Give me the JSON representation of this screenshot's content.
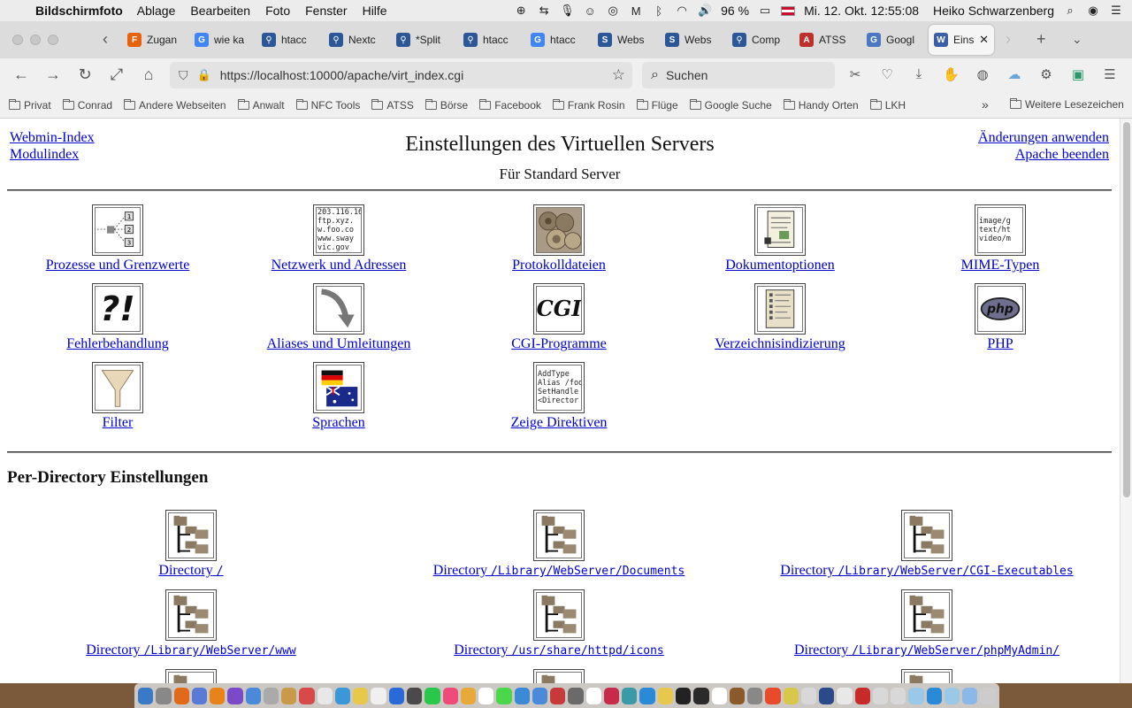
{
  "menubar": {
    "app": "Bildschirmfoto",
    "items": [
      "Ablage",
      "Bearbeiten",
      "Foto",
      "Fenster",
      "Hilfe"
    ],
    "battery": "96 %",
    "datetime": "Mi. 12. Okt.  12:55:08",
    "user": "Heiko Schwarzenberg"
  },
  "tabs": [
    {
      "title": "Zugan",
      "color": "#e8620c",
      "glyph": "F"
    },
    {
      "title": "wie ka",
      "color": "#4285f4",
      "glyph": "G"
    },
    {
      "title": "htacc",
      "color": "#2b5797",
      "glyph": "⚲"
    },
    {
      "title": "Nextc",
      "color": "#2b5797",
      "glyph": "⚲"
    },
    {
      "title": "*Split",
      "color": "#2b5797",
      "glyph": "⚲"
    },
    {
      "title": "htacc",
      "color": "#2b5797",
      "glyph": "⚲"
    },
    {
      "title": "htacc",
      "color": "#4285f4",
      "glyph": "G"
    },
    {
      "title": "Webs",
      "color": "#2b5797",
      "glyph": "S"
    },
    {
      "title": "Webs",
      "color": "#2b5797",
      "glyph": "S"
    },
    {
      "title": "Comp",
      "color": "#2b5797",
      "glyph": "⚲"
    },
    {
      "title": "ATSS",
      "color": "#c0302a",
      "glyph": "A"
    },
    {
      "title": "Googl",
      "color": "#4a78c2",
      "glyph": "G"
    },
    {
      "title": "Einst",
      "color": "#3a5fa8",
      "glyph": "W",
      "active": true
    }
  ],
  "navbar": {
    "url": "https://localhost:10000/apache/virt_index.cgi",
    "search_placeholder": "Suchen"
  },
  "bookmarks": [
    "Privat",
    "Conrad",
    "Andere Webseiten",
    "Anwalt",
    "NFC Tools",
    "ATSS",
    "Börse",
    "Facebook",
    "Frank Rosin",
    "Flüge",
    "Google Suche",
    "Handy Orten",
    "LKH"
  ],
  "bookmarks_more": "Weitere Lesezeichen",
  "page": {
    "links_left": [
      "Webmin-Index",
      "Modulindex"
    ],
    "links_right": [
      "Änderungen anwenden",
      "Apache beenden"
    ],
    "title": "Einstellungen des Virtuellen Servers",
    "subtitle": "Für Standard Server",
    "icons": [
      {
        "label": "Prozesse und Grenzwerte",
        "icon": "process-limits-icon"
      },
      {
        "label": "Netzwerk und Adressen",
        "icon": "network-icon",
        "text": "203.116.16\nftp.xyz.\nw.foo.co\nwww.sway\nvic.gov"
      },
      {
        "label": "Protokolldateien",
        "icon": "log-files-icon"
      },
      {
        "label": "Dokumentoptionen",
        "icon": "document-options-icon"
      },
      {
        "label": "MIME-Typen",
        "icon": "mime-types-icon",
        "text": "image/g\ntext/ht\nvideo/m"
      },
      {
        "label": "Fehlerbehandlung",
        "icon": "error-handling-icon",
        "text": "?!"
      },
      {
        "label": "Aliases und Umleitungen",
        "icon": "redirect-arrow-icon"
      },
      {
        "label": "CGI-Programme",
        "icon": "cgi-icon",
        "text": "CGI"
      },
      {
        "label": "Verzeichnisindizierung",
        "icon": "directory-index-icon"
      },
      {
        "label": "PHP",
        "icon": "php-icon",
        "text": "php"
      },
      {
        "label": "Filter",
        "icon": "filter-funnel-icon"
      },
      {
        "label": "Sprachen",
        "icon": "languages-flags-icon"
      },
      {
        "label": "Zeige Direktiven",
        "icon": "directives-icon",
        "text": "AddType\nAlias /foo\nSetHandle\n<Director"
      }
    ],
    "per_dir_heading": "Per-Directory Einstellungen",
    "dir_label": "Directory",
    "directories": [
      "/",
      "/Library/WebServer/Documents",
      "/Library/WebServer/CGI-Executables",
      "/Library/WebServer/www",
      "/usr/share/httpd/icons",
      "/Library/WebServer/phpMyAdmin/"
    ]
  }
}
